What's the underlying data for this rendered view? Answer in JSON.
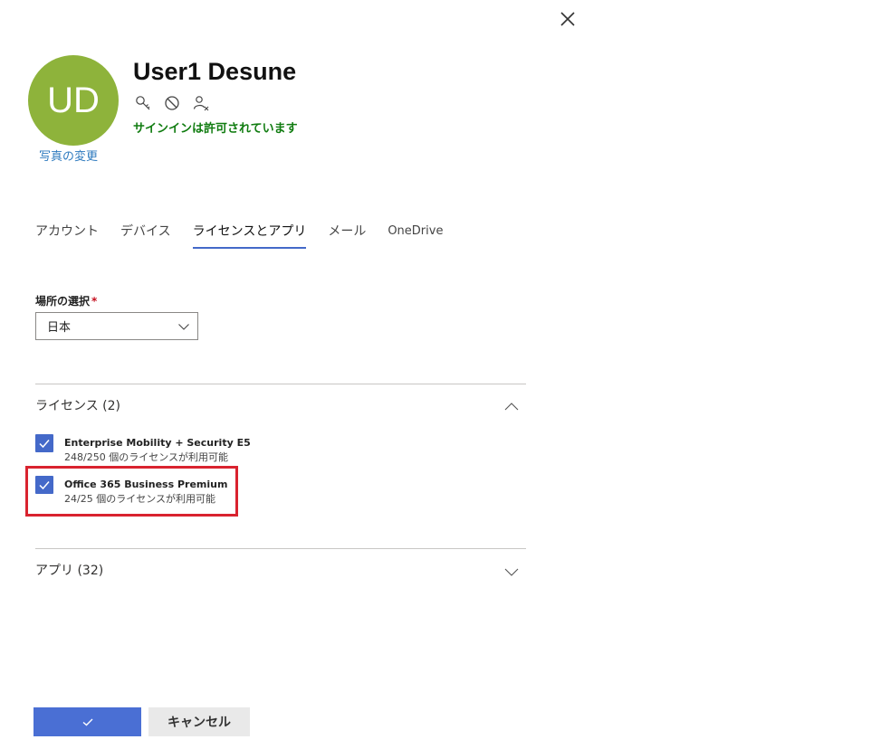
{
  "user": {
    "initials": "UD",
    "name": "User1 Desune",
    "change_photo": "写真の変更",
    "signin_status": "サインインは許可されています",
    "avatar_color": "#8eb33b",
    "status_color": "#107c10",
    "actions": [
      "key-icon",
      "block-icon",
      "user-delete-icon"
    ]
  },
  "tabs": [
    {
      "label": "アカウント",
      "active": false
    },
    {
      "label": "デバイス",
      "active": false
    },
    {
      "label": "ライセンスとアプリ",
      "active": true
    },
    {
      "label": "メール",
      "active": false
    },
    {
      "label": "OneDrive",
      "active": false
    }
  ],
  "location": {
    "label": "場所の選択",
    "required_mark": "*",
    "value": "日本"
  },
  "licenses": {
    "header": "ライセンス (2)",
    "expanded": true,
    "items": [
      {
        "name": "Enterprise Mobility + Security E5",
        "availability": "248/250 個のライセンスが利用可能",
        "checked": true
      },
      {
        "name": "Office 365 Business Premium",
        "availability": "24/25 個のライセンスが利用可能",
        "checked": true,
        "highlighted": true
      }
    ]
  },
  "apps": {
    "header": "アプリ (32)",
    "expanded": false
  },
  "footer": {
    "ok_icon": "checkmark-icon",
    "cancel_label": "キャンセル"
  },
  "colors": {
    "accent": "#4469c9",
    "primary_button": "#4a6fd4",
    "highlight": "#d9232f"
  }
}
